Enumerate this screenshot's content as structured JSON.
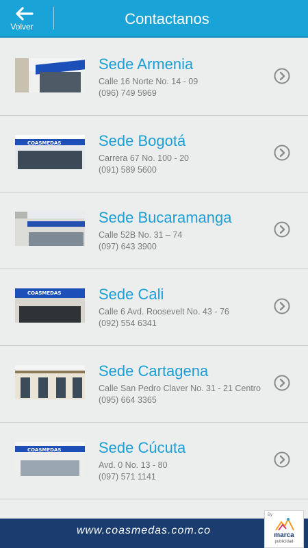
{
  "header": {
    "back_label": "Volver",
    "title": "Contactanos"
  },
  "locations": [
    {
      "name": "Sede Armenia",
      "address": "Calle 16 Norte No. 14 - 09",
      "phone": "(096) 749 5969"
    },
    {
      "name": "Sede Bogotá",
      "address": "Carrera 67 No. 100 - 20",
      "phone": "(091) 589 5600"
    },
    {
      "name": "Sede Bucaramanga",
      "address": "Calle 52B No. 31 – 74",
      "phone": "(097) 643 3900"
    },
    {
      "name": "Sede Cali",
      "address": "Calle 6 Avd. Roosevelt No. 43 - 76",
      "phone": "(092) 554 6341"
    },
    {
      "name": "Sede Cartagena",
      "address": "Calle San Pedro Claver No. 31 - 21 Centro",
      "phone": "(095) 664 3365"
    },
    {
      "name": "Sede Cúcuta",
      "address": "Avd. 0 No. 13 - 80",
      "phone": "(097) 571 1141"
    }
  ],
  "sign_text": "COASMEDAS",
  "footer": {
    "url": "www.coasmedas.com.co"
  },
  "badge": {
    "by": "By",
    "brand": "marca",
    "sub": "publicidad"
  },
  "colors": {
    "header": "#1aa3d6",
    "accent_text": "#1c9fd6",
    "footer": "#1b3c6f"
  }
}
